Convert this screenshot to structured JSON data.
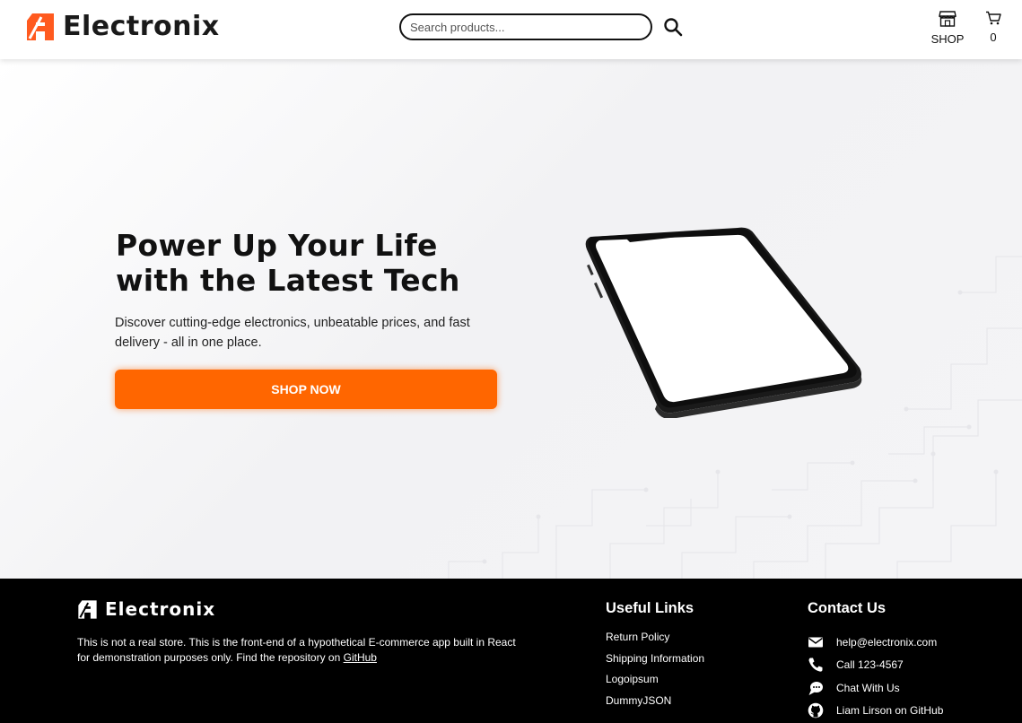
{
  "header": {
    "brand": "Electronix",
    "search_placeholder": "Search products...",
    "shop_label": "SHOP",
    "cart_count": "0"
  },
  "hero": {
    "title": "Power Up Your Life with the Latest Tech",
    "subtitle": "Discover cutting-edge electronics, unbeatable prices, and fast delivery - all in one place.",
    "cta_label": "SHOP NOW"
  },
  "footer": {
    "brand": "Electronix",
    "description": "This is not a real store. This is the front-end of a hypothetical E-commerce app built in React for demonstration purposes only. Find the repository on",
    "repo_link": "GitHub",
    "useful_links_title": "Useful Links",
    "useful_links": [
      "Return Policy",
      "Shipping Information",
      "Logoipsum",
      "DummyJSON"
    ],
    "contact_title": "Contact Us",
    "contact": [
      {
        "icon": "email-icon",
        "label": "help@electronix.com"
      },
      {
        "icon": "phone-icon",
        "label": "Call 123-4567"
      },
      {
        "icon": "chat-icon",
        "label": "Chat With Us"
      },
      {
        "icon": "github-icon",
        "label": "Liam Lirson on GitHub"
      }
    ]
  },
  "colors": {
    "accent": "#ff6600",
    "footer_bg": "#000000",
    "text": "#111111"
  }
}
